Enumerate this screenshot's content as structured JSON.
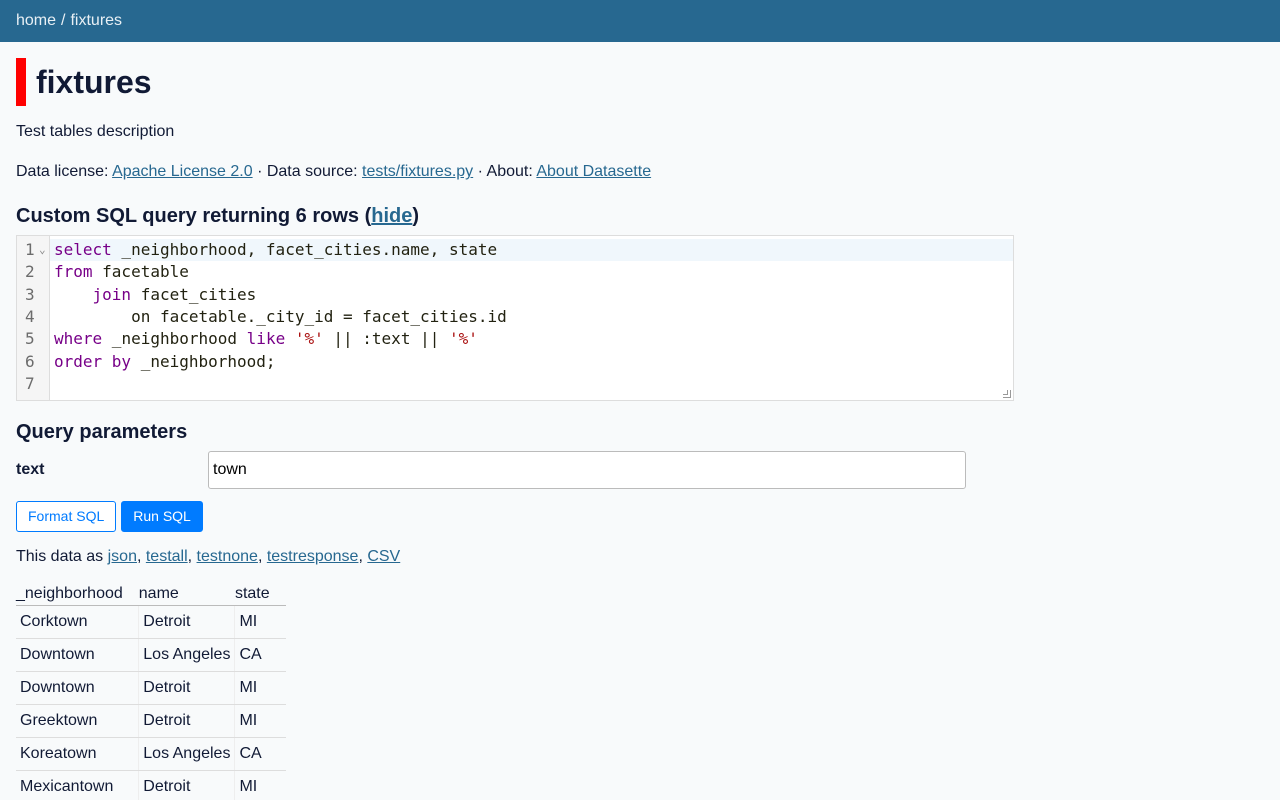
{
  "nav": {
    "home": "home",
    "separator": "/",
    "current": "fixtures"
  },
  "page": {
    "title": "fixtures",
    "description": "Test tables description"
  },
  "license": {
    "license_label": "Data license:",
    "license_link": "Apache License 2.0",
    "dot1": "·",
    "source_label": "Data source:",
    "source_link": "tests/fixtures.py",
    "dot2": "·",
    "about_label": "About:",
    "about_link": "About Datasette"
  },
  "sql": {
    "heading_prefix": "Custom SQL query returning 6 rows (",
    "hide_link": "hide",
    "heading_suffix": ")",
    "line_numbers": [
      "1",
      "2",
      "3",
      "4",
      "5",
      "6",
      "7"
    ],
    "fold_marker": "⌄"
  },
  "params": {
    "heading": "Query parameters",
    "text_label": "text",
    "text_value": "town"
  },
  "buttons": {
    "format": "Format SQL",
    "run": "Run SQL"
  },
  "export": {
    "prefix": "This data as",
    "formats": [
      "json",
      "testall",
      "testnone",
      "testresponse",
      "CSV"
    ]
  },
  "table": {
    "columns": [
      "_neighborhood",
      "name",
      "state"
    ],
    "rows": [
      [
        "Corktown",
        "Detroit",
        "MI"
      ],
      [
        "Downtown",
        "Los Angeles",
        "CA"
      ],
      [
        "Downtown",
        "Detroit",
        "MI"
      ],
      [
        "Greektown",
        "Detroit",
        "MI"
      ],
      [
        "Koreatown",
        "Los Angeles",
        "CA"
      ],
      [
        "Mexicantown",
        "Detroit",
        "MI"
      ]
    ]
  },
  "colors": {
    "header_bg": "#276890",
    "accent_bar": "#ff0000",
    "link": "#276890",
    "primary_button": "#007bff"
  }
}
